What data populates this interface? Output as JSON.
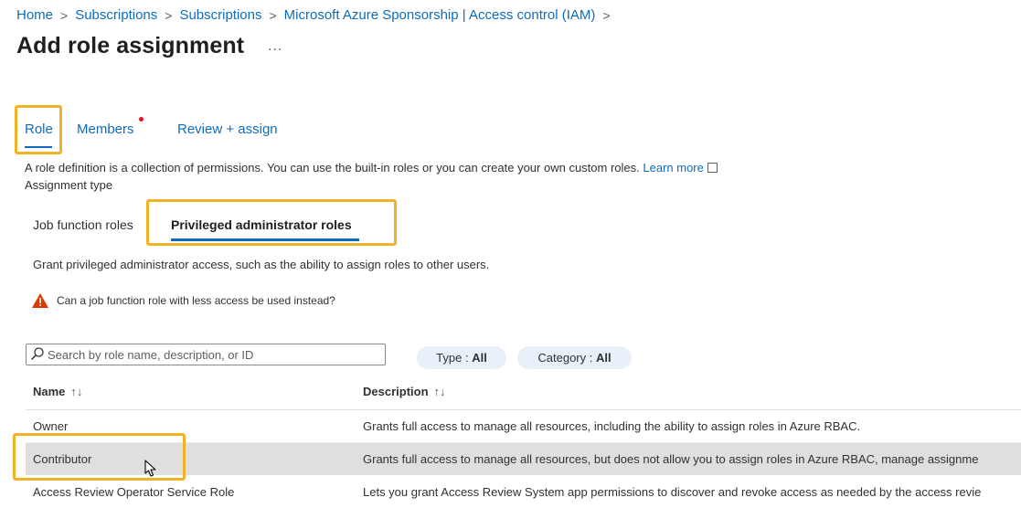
{
  "breadcrumb": [
    "Home",
    "Subscriptions",
    "Subscriptions",
    "Microsoft Azure Sponsorship | Access control (IAM)"
  ],
  "breadcrumb_separator": ">",
  "page_title": "Add role assignment",
  "more_icon": "...",
  "tabs": {
    "role": "Role",
    "members": "Members",
    "review": "Review + assign"
  },
  "description": {
    "text": "A role definition is a collection of permissions. You can use the built-in roles or you can create your own custom roles.",
    "learn_more": "Learn more"
  },
  "assignment_type_label": "Assignment type",
  "subtabs": {
    "job": "Job function roles",
    "privileged": "Privileged administrator roles"
  },
  "grant_text": "Grant privileged administrator access, such as the ability to assign roles to other users.",
  "warning_text": "Can a job function role with less access be used instead?",
  "search": {
    "placeholder": "Search by role name, description, or ID"
  },
  "filters": {
    "type_label": "Type :",
    "type_value": "All",
    "category_label": "Category :",
    "category_value": "All"
  },
  "table": {
    "headers": {
      "name": "Name",
      "description": "Description"
    },
    "sort_icon": "↑↓",
    "rows": [
      {
        "name": "Owner",
        "description": "Grants full access to manage all resources, including the ability to assign roles in Azure RBAC."
      },
      {
        "name": "Contributor",
        "description": "Grants full access to manage all resources, but does not allow you to assign roles in Azure RBAC, manage assignme"
      },
      {
        "name": "Access Review Operator Service Role",
        "description": "Lets you grant Access Review System app permissions to discover and revoke access as needed by the access revie"
      }
    ]
  },
  "colors": {
    "accent": "#0f6cbd",
    "highlight": "#f2b227",
    "warning": "#d83b01",
    "selected_row": "#e1dfdd"
  }
}
